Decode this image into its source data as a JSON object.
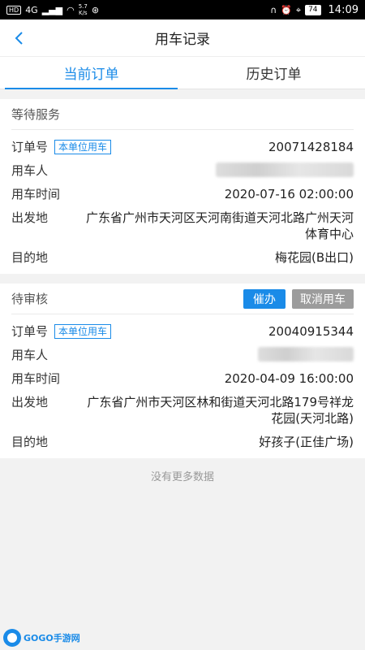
{
  "status_bar": {
    "hd": "HD",
    "network": "4G",
    "speed_value": "5.7",
    "speed_unit": "K/s",
    "battery": "74",
    "time": "14:09"
  },
  "nav": {
    "title": "用车记录"
  },
  "tabs": [
    {
      "label": "当前订单",
      "active": true
    },
    {
      "label": "历史订单",
      "active": false
    }
  ],
  "orders": [
    {
      "status": "等待服务",
      "order_no_label": "订单号",
      "tag": "本单位用车",
      "order_no": "20071428184",
      "user_label": "用车人",
      "time_label": "用车时间",
      "time": "2020-07-16 02:00:00",
      "from_label": "出发地",
      "from": "广东省广州市天河区天河南街道天河北路广州天河体育中心",
      "to_label": "目的地",
      "to": "梅花园(B出口)"
    },
    {
      "status": "待审核",
      "urge_label": "催办",
      "cancel_label": "取消用车",
      "order_no_label": "订单号",
      "tag": "本单位用车",
      "order_no": "20040915344",
      "user_label": "用车人",
      "time_label": "用车时间",
      "time": "2020-04-09 16:00:00",
      "from_label": "出发地",
      "from": "广东省广州市天河区林和街道天河北路179号祥龙花园(天河北路)",
      "to_label": "目的地",
      "to": "好孩子(正佳广场)"
    }
  ],
  "footer_note": "没有更多数据",
  "watermark": "GOGO手游网",
  "colors": {
    "accent": "#1a8be8",
    "cancel": "#9c9c9c"
  },
  "icons": [
    "back-arrow-icon",
    "wifi-icon",
    "signal-icon",
    "battery-icon",
    "alarm-icon",
    "location-icon",
    "headset-icon"
  ]
}
